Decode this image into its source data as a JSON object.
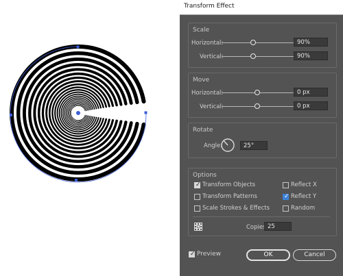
{
  "dialog": {
    "title": "Transform Effect",
    "scale": {
      "group_label": "Scale",
      "horizontal_label": "Horizontal:",
      "horizontal_value": "90%",
      "vertical_label": "Vertical:",
      "vertical_value": "90%"
    },
    "move": {
      "group_label": "Move",
      "horizontal_label": "Horizontal:",
      "horizontal_value": "0 px",
      "vertical_label": "Vertical:",
      "vertical_value": "0 px"
    },
    "rotate": {
      "group_label": "Rotate",
      "angle_label": "Angle:",
      "angle_value": "25°"
    },
    "options": {
      "group_label": "Options",
      "transform_objects": {
        "label": "Transform Objects",
        "checked": true
      },
      "transform_patterns": {
        "label": "Transform Patterns",
        "checked": false
      },
      "scale_strokes": {
        "label": "Scale Strokes & Effects",
        "checked": false
      },
      "reflect_x": {
        "label": "Reflect X",
        "checked": false
      },
      "reflect_y": {
        "label": "Reflect Y",
        "checked": true
      },
      "random": {
        "label": "Random",
        "checked": false
      },
      "copies_label": "Copies",
      "copies_value": "25"
    },
    "preview": {
      "label": "Preview",
      "checked": true
    },
    "ok_label": "OK",
    "cancel_label": "Cancel"
  },
  "colors": {
    "dialog_bg": "#535353",
    "selection_blue": "#3d5fd6",
    "checkbox_blue": "#3d82d6"
  }
}
